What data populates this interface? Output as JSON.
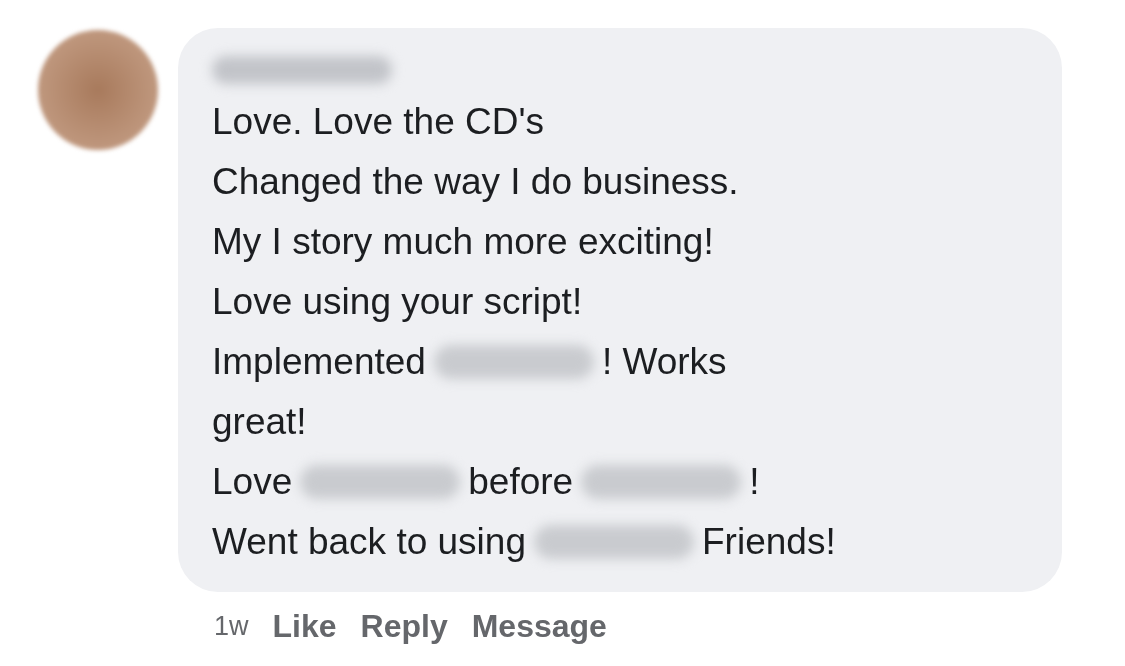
{
  "comment": {
    "lines": [
      [
        {
          "kind": "text",
          "text": "Love. Love the CD's"
        }
      ],
      [
        {
          "kind": "text",
          "text": "Changed the way I do business."
        }
      ],
      [
        {
          "kind": "text",
          "text": "My I story much more exciting!"
        }
      ],
      [
        {
          "kind": "text",
          "text": "Love using your script!"
        }
      ],
      [
        {
          "kind": "text",
          "text": "Implemented"
        },
        {
          "kind": "redacted"
        },
        {
          "kind": "text",
          "text": "! Works"
        }
      ],
      [
        {
          "kind": "text",
          "text": "great!"
        }
      ],
      [
        {
          "kind": "text",
          "text": "Love"
        },
        {
          "kind": "redacted"
        },
        {
          "kind": "text",
          "text": "before"
        },
        {
          "kind": "redacted"
        },
        {
          "kind": "text",
          "text": "!"
        }
      ],
      [
        {
          "kind": "text",
          "text": "Went back to using"
        },
        {
          "kind": "redacted"
        },
        {
          "kind": "text",
          "text": "Friends!"
        }
      ]
    ]
  },
  "footer": {
    "time": "1w",
    "actions": [
      "Like",
      "Reply",
      "Message"
    ]
  }
}
